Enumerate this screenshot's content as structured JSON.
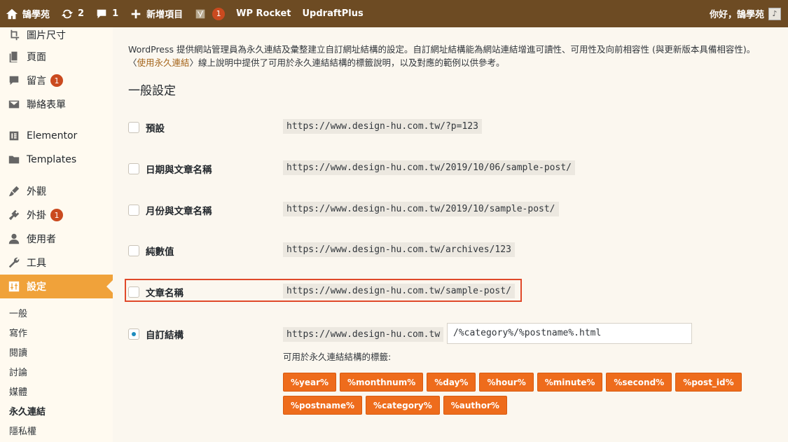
{
  "adminbar": {
    "site_name": "鵠學苑",
    "updates_count": "2",
    "comments_count": "1",
    "new_label": "新增項目",
    "yoast_badge": "1",
    "wp_rocket": "WP Rocket",
    "updraft": "UpdraftPlus",
    "greeting": "你好，鵠學苑"
  },
  "sidebar": {
    "items": [
      {
        "label": "圖片尺寸",
        "icon": "crop-icon"
      },
      {
        "label": "頁面",
        "icon": "page-icon"
      },
      {
        "label": "留言",
        "icon": "comment-icon",
        "badge": "1"
      },
      {
        "label": "聯絡表單",
        "icon": "mail-icon"
      },
      {
        "label": "Elementor",
        "icon": "elementor-icon"
      },
      {
        "label": "Templates",
        "icon": "folder-icon"
      },
      {
        "label": "外觀",
        "icon": "brush-icon"
      },
      {
        "label": "外掛",
        "icon": "plugin-icon",
        "badge": "1"
      },
      {
        "label": "使用者",
        "icon": "user-icon"
      },
      {
        "label": "工具",
        "icon": "wrench-icon"
      },
      {
        "label": "設定",
        "icon": "settings-icon"
      }
    ],
    "submenu": [
      "一般",
      "寫作",
      "閱讀",
      "討論",
      "媒體",
      "永久連結",
      "隱私權"
    ]
  },
  "main": {
    "desc_line1": "WordPress 提供網站管理員為永久連結及彙整建立自訂網址結構的設定。自訂網址結構能為網站連結增進可讀性、可用性及向前相容性 (與更新版本具備相容性)。",
    "desc_prefix": "〈",
    "desc_link": "使用永久連結",
    "desc_suffix": "〉線上說明中提供了可用於永久連結結構的標籤說明，以及對應的範例以供參考。",
    "section_title": "一般設定",
    "options": [
      {
        "label": "預設",
        "url": "https://www.design-hu.com.tw/?p=123",
        "checked": false
      },
      {
        "label": "日期與文章名稱",
        "url": "https://www.design-hu.com.tw/2019/10/06/sample-post/",
        "checked": false
      },
      {
        "label": "月份與文章名稱",
        "url": "https://www.design-hu.com.tw/2019/10/sample-post/",
        "checked": false
      },
      {
        "label": "純數值",
        "url": "https://www.design-hu.com.tw/archives/123",
        "checked": false
      },
      {
        "label": "文章名稱",
        "url": "https://www.design-hu.com.tw/sample-post/",
        "checked": false
      },
      {
        "label": "自訂結構",
        "url": "https://www.design-hu.com.tw",
        "checked": true
      }
    ],
    "custom_value": "/%category%/%postname%.html",
    "available_tags_label": "可用於永久連結結構的標籤:",
    "tags_row1": [
      "%year%",
      "%monthnum%",
      "%day%",
      "%hour%",
      "%minute%",
      "%second%",
      "%post_id%"
    ],
    "tags_row2": [
      "%postname%",
      "%category%",
      "%author%"
    ]
  },
  "colors": {
    "adminbar": "#6d4b23",
    "active_menu": "#f0a23a",
    "tag": "#ee6c1c",
    "highlight": "#e0492a"
  }
}
